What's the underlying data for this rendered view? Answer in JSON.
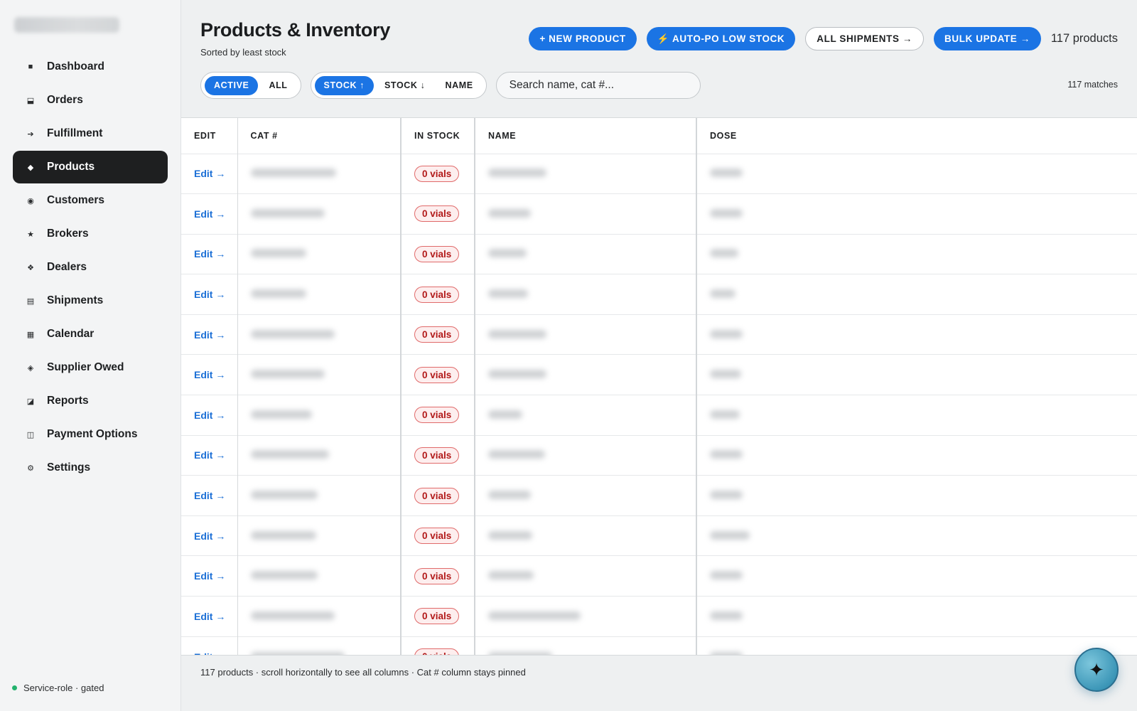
{
  "sidebar": {
    "items": [
      {
        "label": "Dashboard",
        "icon": "■",
        "icon_name": "dashboard-icon"
      },
      {
        "label": "Orders",
        "icon": "⬓",
        "icon_name": "orders-icon"
      },
      {
        "label": "Fulfillment",
        "icon": "➔",
        "icon_name": "fulfillment-arrow-icon"
      },
      {
        "label": "Products",
        "icon": "◆",
        "icon_name": "products-icon",
        "active": true
      },
      {
        "label": "Customers",
        "icon": "◉",
        "icon_name": "customers-icon"
      },
      {
        "label": "Brokers",
        "icon": "★",
        "icon_name": "brokers-star-icon"
      },
      {
        "label": "Dealers",
        "icon": "❖",
        "icon_name": "dealers-icon"
      },
      {
        "label": "Shipments",
        "icon": "▤",
        "icon_name": "shipments-icon"
      },
      {
        "label": "Calendar",
        "icon": "▦",
        "icon_name": "calendar-icon"
      },
      {
        "label": "Supplier Owed",
        "icon": "◈",
        "icon_name": "supplier-owed-icon"
      },
      {
        "label": "Reports",
        "icon": "◪",
        "icon_name": "reports-icon"
      },
      {
        "label": "Payment Options",
        "icon": "◫",
        "icon_name": "payment-options-icon"
      },
      {
        "label": "Settings",
        "icon": "⚙",
        "icon_name": "settings-gear-icon"
      }
    ],
    "status_text": "Service-role · gated"
  },
  "header": {
    "title": "Products & Inventory",
    "subtitle": "Sorted by least stock",
    "new_product_label": "+ NEW PRODUCT",
    "auto_po_label": "⚡ AUTO-PO LOW STOCK",
    "all_shipments_label": "ALL SHIPMENTS →",
    "bulk_update_label": "BULK UPDATE →",
    "product_count": "117 products"
  },
  "filters": {
    "status": {
      "active_label": "ACTIVE",
      "all_label": "ALL",
      "selected": "ACTIVE"
    },
    "sort": {
      "stock_asc_label": "STOCK ↑",
      "stock_desc_label": "STOCK ↓",
      "name_label": "NAME",
      "selected": "STOCK ↑"
    },
    "search_placeholder": "Search name, cat #...",
    "matches": "117 matches"
  },
  "table": {
    "columns": {
      "edit": "EDIT",
      "cat": "CAT #",
      "stock": "IN STOCK",
      "name": "NAME",
      "dose": "DOSE"
    },
    "edit_label": "Edit →",
    "stock_label": "0 vials",
    "row_count": 13
  },
  "footer_note": "117 products · scroll horizontally to see all columns · Cat # column stays pinned",
  "colors": {
    "accent": "#1b74e4",
    "stock_badge": "#b21919",
    "status_dot": "#23b26d",
    "active_nav": "#1e1f20"
  }
}
